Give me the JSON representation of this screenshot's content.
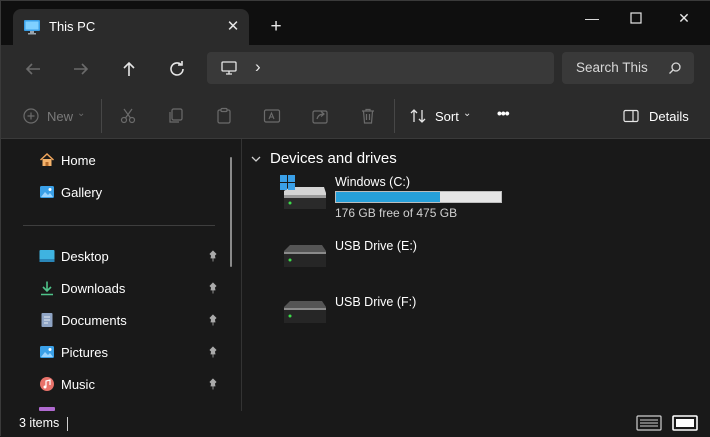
{
  "window": {
    "tab_title": "This PC",
    "new_tab": "+",
    "minimize": "—",
    "maximize": "☐",
    "close": "✕"
  },
  "address": {
    "breadcrumb_separator": "›",
    "search_placeholder": "Search This"
  },
  "toolbar": {
    "new_label": "New",
    "sort_label": "Sort",
    "more_label": "•••",
    "details_label": "Details"
  },
  "sidebar": {
    "items": [
      {
        "label": "Home",
        "icon": "home-icon"
      },
      {
        "label": "Gallery",
        "icon": "gallery-icon"
      },
      {
        "label": "Desktop",
        "icon": "desktop-icon",
        "pinned": true
      },
      {
        "label": "Downloads",
        "icon": "downloads-icon",
        "pinned": true
      },
      {
        "label": "Documents",
        "icon": "documents-icon",
        "pinned": true
      },
      {
        "label": "Pictures",
        "icon": "pictures-icon",
        "pinned": true
      },
      {
        "label": "Music",
        "icon": "music-icon",
        "pinned": true
      }
    ]
  },
  "content": {
    "group_title": "Devices and drives",
    "drives": [
      {
        "name": "Windows (C:)",
        "free_text": "176 GB free of 475 GB",
        "used_fraction": 0.63
      },
      {
        "name": "USB Drive (E:)"
      },
      {
        "name": "USB Drive (F:)"
      }
    ]
  },
  "status": {
    "item_count": "3 items"
  },
  "colors": {
    "accent": "#26a0da",
    "background": "#191919",
    "toolbar": "#2b2b2b"
  }
}
